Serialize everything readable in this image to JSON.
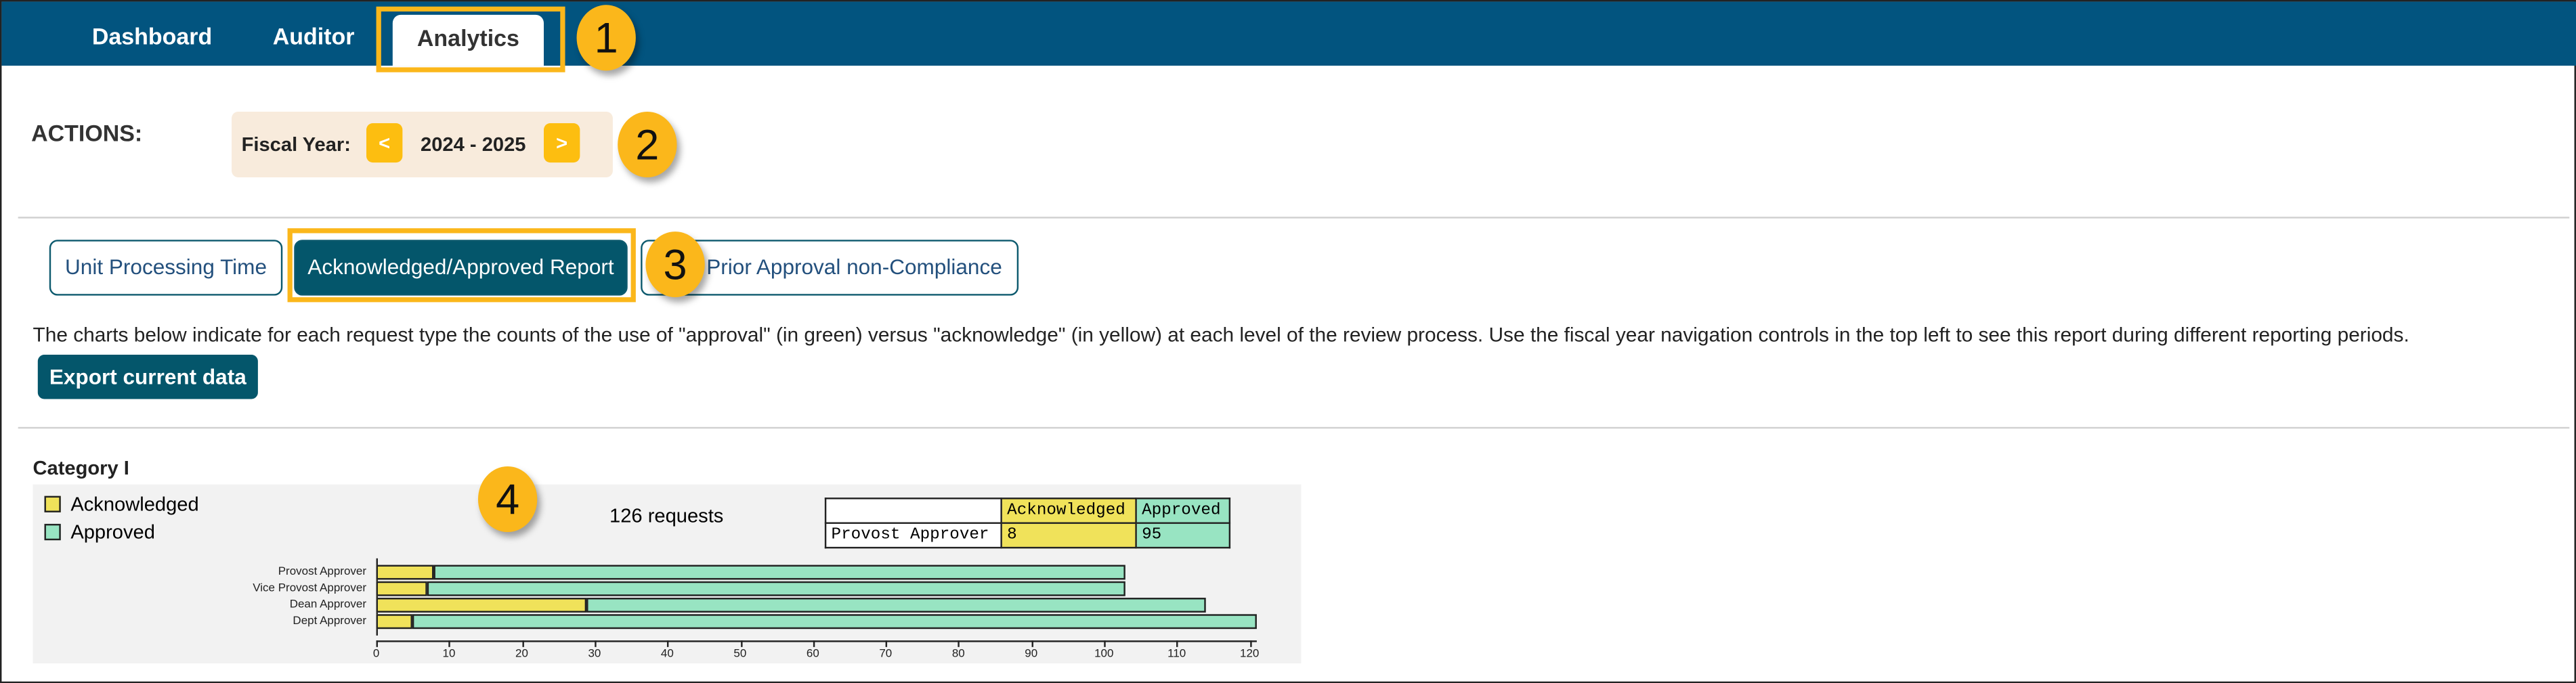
{
  "nav": {
    "tabs": [
      "Dashboard",
      "Auditor",
      "Analytics"
    ],
    "active": "Analytics"
  },
  "badges": [
    "1",
    "2",
    "3",
    "4"
  ],
  "actions": {
    "label": "ACTIONS:",
    "fiscal_label": "Fiscal Year:",
    "prev": "<",
    "next": ">",
    "fiscal_value": "2024 - 2025"
  },
  "report_tabs": [
    "Unit Processing Time",
    "Acknowledged/Approved Report",
    "Prior Approval non-Compliance"
  ],
  "description": "The charts below indicate for each request type the counts of the use of \"approval\" (in green) versus \"acknowledge\" (in yellow) at each level of the review process. Use the fiscal year navigation controls in the top left to see this report during different reporting periods.",
  "export_label": "Export current data",
  "category": "Category I",
  "colors": {
    "acknowledged": "#f0e25a",
    "approved": "#98e4c2",
    "nav": "#02547f",
    "button": "#04566b",
    "highlight": "#fbb71b"
  },
  "tooltip_table": {
    "headers": [
      "",
      "Acknowledged",
      "Approved"
    ],
    "row": [
      "Provost Approver",
      "8",
      "95"
    ]
  },
  "chart_data": {
    "type": "bar",
    "orientation": "horizontal",
    "stacked": true,
    "title": "126 requests",
    "categories": [
      "Provost Approver",
      "Vice Provost Approver",
      "Dean Approver",
      "Dept Approver"
    ],
    "series": [
      {
        "name": "Acknowledged",
        "values": [
          8,
          7,
          29,
          5
        ]
      },
      {
        "name": "Approved",
        "values": [
          95,
          96,
          85,
          116
        ]
      }
    ],
    "xlim": [
      0,
      121
    ],
    "xticks": [
      "0",
      "10",
      "20",
      "30",
      "40",
      "50",
      "60",
      "70",
      "80",
      "90",
      "100",
      "110",
      "120"
    ],
    "legend": "top-left",
    "grid": false
  }
}
